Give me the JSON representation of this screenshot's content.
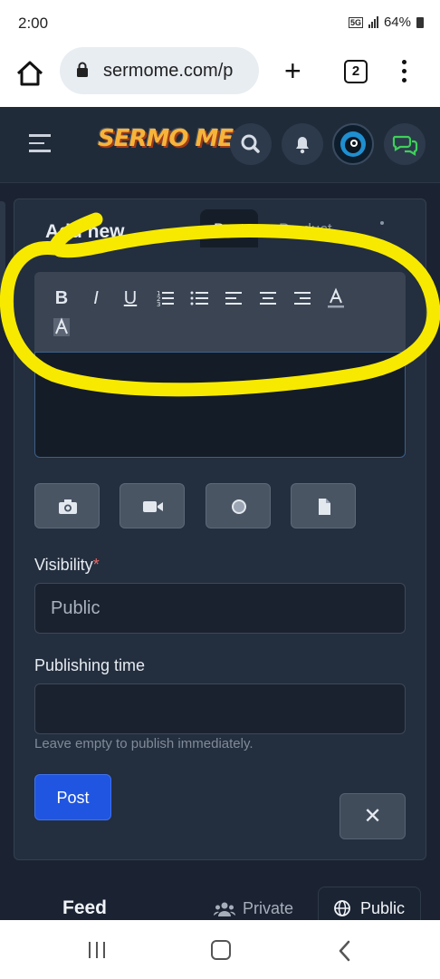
{
  "status_bar": {
    "time": "2:00",
    "network": "5G",
    "battery": "64%"
  },
  "browser": {
    "url": "sermome.com/p",
    "tab_count": "2"
  },
  "header": {
    "logo_text": "SERMO ME"
  },
  "composer": {
    "title": "Add new",
    "tabs": [
      "Post",
      "Product"
    ],
    "toolbar": {
      "bold": "B",
      "italic": "I",
      "underline": "U"
    },
    "visibility_label": "Visibility",
    "required_mark": "*",
    "visibility_value": "Public",
    "publishing_label": "Publishing time",
    "publishing_value": "",
    "publishing_hint": "Leave empty to publish immediately.",
    "post_button": "Post",
    "close_button": "✕"
  },
  "feed": {
    "title": "Feed",
    "private_label": "Private",
    "public_label": "Public"
  },
  "colors": {
    "accent": "#1f55e0",
    "marker": "#f7ea00",
    "logo": "#f6b43a",
    "chat": "#3ecf5a"
  }
}
